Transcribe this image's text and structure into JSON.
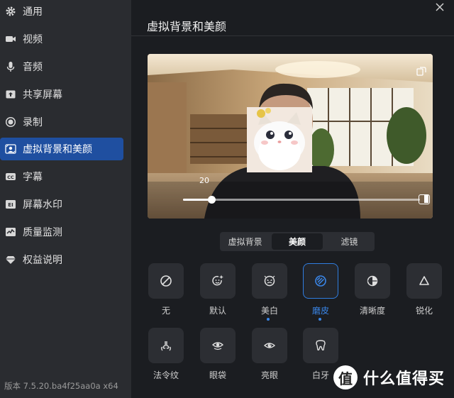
{
  "sidebar": {
    "items": [
      {
        "label": "通用",
        "icon": "gear-icon"
      },
      {
        "label": "视频",
        "icon": "video-camera-icon"
      },
      {
        "label": "音频",
        "icon": "microphone-icon"
      },
      {
        "label": "共享屏幕",
        "icon": "share-screen-icon"
      },
      {
        "label": "录制",
        "icon": "record-icon"
      },
      {
        "label": "虚拟背景和美颜",
        "icon": "virtual-background-icon",
        "active": true
      },
      {
        "label": "字幕",
        "icon": "caption-icon"
      },
      {
        "label": "屏幕水印",
        "icon": "watermark-icon"
      },
      {
        "label": "质量监测",
        "icon": "quality-monitor-icon"
      },
      {
        "label": "权益说明",
        "icon": "diamond-icon"
      }
    ],
    "version": "版本 7.5.20.ba4f25aa0a x64"
  },
  "main": {
    "title": "虚拟背景和美颜",
    "slider": {
      "value": "20",
      "fraction": 0.12
    },
    "tabs": [
      {
        "label": "虚拟背景"
      },
      {
        "label": "美颜",
        "active": true
      },
      {
        "label": "滤镜"
      }
    ],
    "effects": [
      {
        "label": "无",
        "icon": "none-icon"
      },
      {
        "label": "默认",
        "icon": "smile-sparkle-icon"
      },
      {
        "label": "美白",
        "icon": "whitening-face-icon",
        "dot": true
      },
      {
        "label": "磨皮",
        "icon": "smoothing-icon",
        "selected": true,
        "dot": true
      },
      {
        "label": "清晰度",
        "icon": "clarity-icon"
      },
      {
        "label": "锐化",
        "icon": "sharpen-triangle-icon"
      },
      {
        "label": "法令纹",
        "icon": "nose-lines-icon"
      },
      {
        "label": "眼袋",
        "icon": "eye-bags-icon"
      },
      {
        "label": "亮眼",
        "icon": "bright-eye-icon"
      },
      {
        "label": "白牙",
        "icon": "tooth-icon"
      }
    ]
  },
  "watermark": {
    "text": "什么值得买",
    "logo": "值"
  },
  "colors": {
    "accent": "#2f7de0",
    "active_nav": "#1f4fa0",
    "sidebar_bg": "#2a2c30",
    "main_bg": "#1b1d21"
  }
}
